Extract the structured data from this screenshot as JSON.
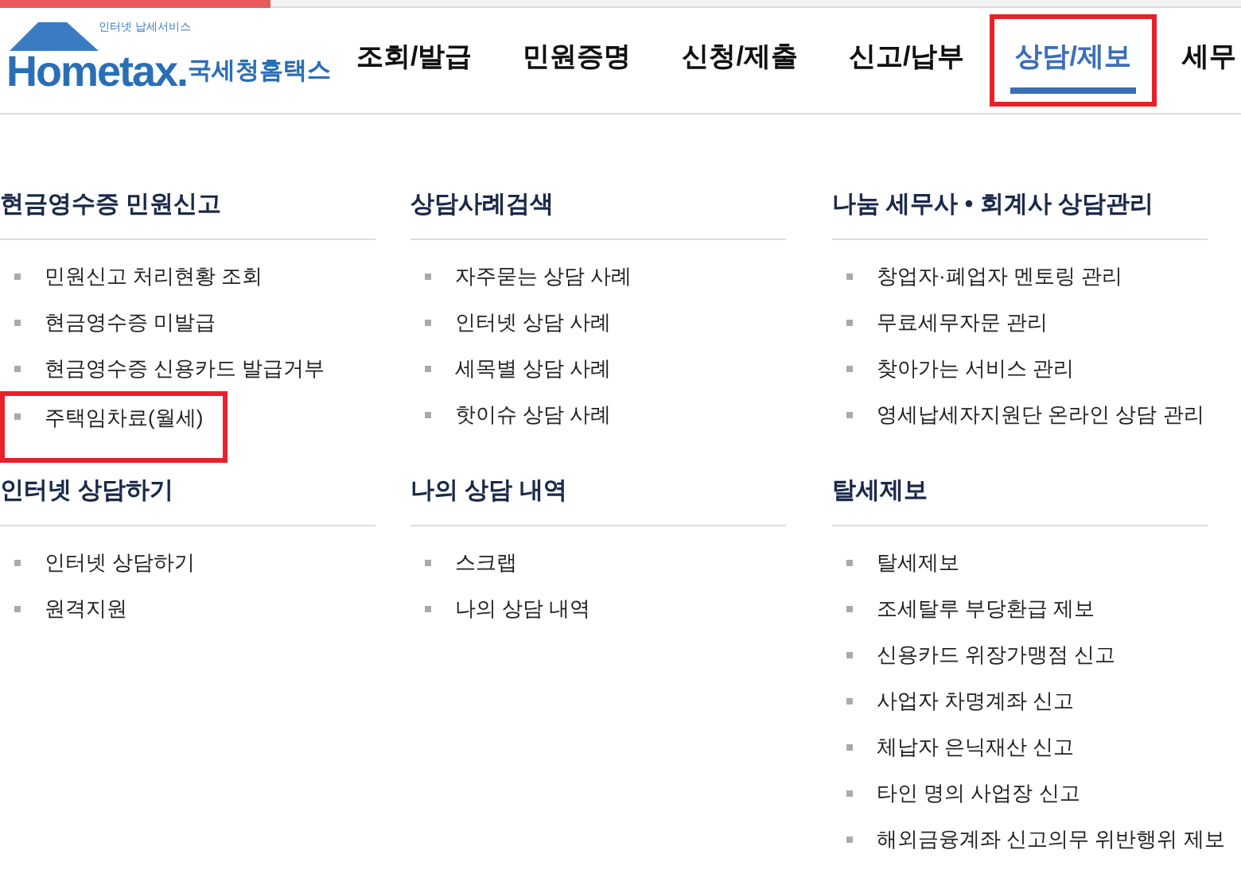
{
  "logo": {
    "tagline": "인터넷 납세서비스",
    "wordmark": "Hometax.",
    "name": "국세청홈택스"
  },
  "nav": [
    {
      "label": "조회/발급",
      "selected": false,
      "highlighted": false
    },
    {
      "label": "민원증명",
      "selected": false,
      "highlighted": false
    },
    {
      "label": "신청/제출",
      "selected": false,
      "highlighted": false
    },
    {
      "label": "신고/납부",
      "selected": false,
      "highlighted": false
    },
    {
      "label": "상담/제보",
      "selected": true,
      "highlighted": true
    },
    {
      "label": "세무",
      "selected": false,
      "highlighted": false
    }
  ],
  "columns": [
    {
      "sections": [
        {
          "heading": "현금영수증 민원신고",
          "items": [
            {
              "label": "민원신고 처리현황 조회",
              "highlighted": false
            },
            {
              "label": "현금영수증 미발급",
              "highlighted": false
            },
            {
              "label": "현금영수증 신용카드 발급거부",
              "highlighted": false
            },
            {
              "label": "주택임차료(월세)",
              "highlighted": true
            }
          ]
        },
        {
          "heading": "인터넷 상담하기",
          "items": [
            {
              "label": "인터넷 상담하기",
              "highlighted": false
            },
            {
              "label": "원격지원",
              "highlighted": false
            }
          ]
        }
      ]
    },
    {
      "sections": [
        {
          "heading": "상담사례검색",
          "items": [
            {
              "label": "자주묻는 상담 사례",
              "highlighted": false
            },
            {
              "label": "인터넷 상담 사례",
              "highlighted": false
            },
            {
              "label": "세목별 상담 사례",
              "highlighted": false
            },
            {
              "label": "핫이슈 상담 사례",
              "highlighted": false
            }
          ]
        },
        {
          "heading": "나의 상담 내역",
          "items": [
            {
              "label": "스크랩",
              "highlighted": false
            },
            {
              "label": "나의 상담 내역",
              "highlighted": false
            }
          ]
        }
      ]
    },
    {
      "sections": [
        {
          "heading": "나눔 세무사 • 회계사 상담관리",
          "items": [
            {
              "label": "창업자·폐업자 멘토링 관리",
              "highlighted": false
            },
            {
              "label": "무료세무자문 관리",
              "highlighted": false
            },
            {
              "label": "찾아가는 서비스 관리",
              "highlighted": false
            },
            {
              "label": "영세납세자지원단 온라인 상담 관리",
              "highlighted": false
            }
          ]
        },
        {
          "heading": "탈세제보",
          "items": [
            {
              "label": "탈세제보",
              "highlighted": false
            },
            {
              "label": "조세탈루 부당환급 제보",
              "highlighted": false
            },
            {
              "label": "신용카드 위장가맹점 신고",
              "highlighted": false
            },
            {
              "label": "사업자 차명계좌 신고",
              "highlighted": false
            },
            {
              "label": "체납자 은닉재산 신고",
              "highlighted": false
            },
            {
              "label": "타인 명의 사업장 신고",
              "highlighted": false
            },
            {
              "label": "해외금융계좌 신고의무 위반행위 제보",
              "highlighted": false
            }
          ]
        }
      ]
    }
  ]
}
